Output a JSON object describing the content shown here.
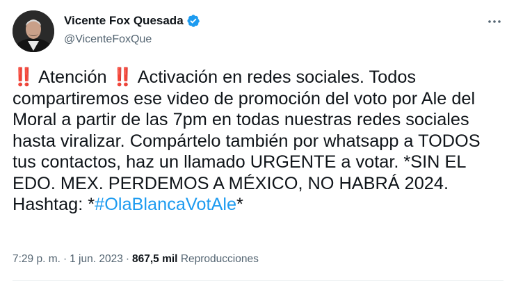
{
  "author": {
    "display_name": "Vicente Fox Quesada",
    "handle": "@VicenteFoxQue",
    "verified": true,
    "avatar_icon": "profile-photo"
  },
  "tweet": {
    "emoji_1": "‼️",
    "text_1": " Atención ",
    "emoji_2": "‼️",
    "text_2": " Activación en redes sociales. Todos compartiremos ese video de promoción del voto por Ale del Moral a partir de las 7pm en todas nuestras redes sociales hasta viralizar. Compártelo también por whatsapp a TODOS tus contactos, haz un llamado URGENTE a votar. *SIN EL EDO. MEX. PERDEMOS A MÉXICO, NO HABRÁ 2024. Hashtag: *",
    "hashtag": "#OlaBlancaVotAle",
    "text_3": "*"
  },
  "meta": {
    "time": "7:29 p. m.",
    "separator": "·",
    "date": "1 jun. 2023",
    "views_count": "867,5 mil",
    "views_label": "Reproducciones"
  },
  "colors": {
    "link": "#1d9bf0",
    "verified_badge": "#1d9bf0",
    "secondary_text": "#536471",
    "emoji_red": "#e0245e"
  }
}
